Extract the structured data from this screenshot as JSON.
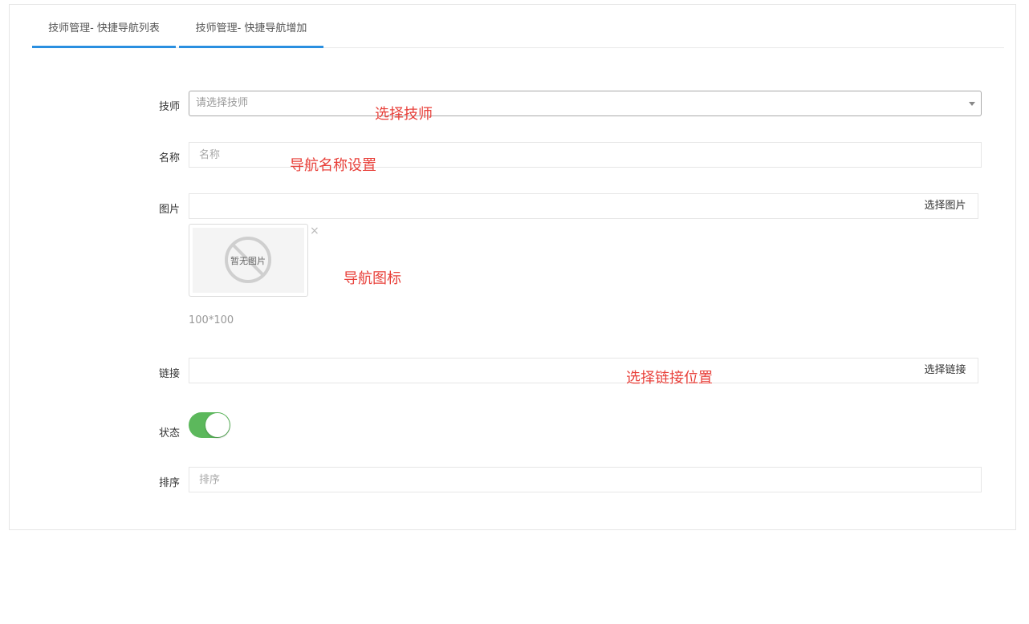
{
  "tabs": [
    {
      "label": "技师管理- 快捷导航列表"
    },
    {
      "label": "技师管理- 快捷导航增加"
    }
  ],
  "form": {
    "technician": {
      "label": "技师",
      "placeholder": "请选择技师",
      "annotation": "选择技师"
    },
    "name": {
      "label": "名称",
      "placeholder": "名称",
      "annotation": "导航名称设置"
    },
    "image": {
      "label": "图片",
      "value": "",
      "button": "选择图片",
      "preview_text": "暂无图片",
      "remove": "×",
      "annotation": "导航图标",
      "size_hint": "100*100"
    },
    "link": {
      "label": "链接",
      "value": "",
      "button": "选择链接",
      "annotation": "选择链接位置"
    },
    "status": {
      "label": "状态",
      "enabled": true
    },
    "sort": {
      "label": "排序",
      "placeholder": "排序"
    }
  },
  "colors": {
    "accent": "#2a8fe0",
    "annotation": "#e8403a",
    "toggle_on": "#5cb85c"
  }
}
